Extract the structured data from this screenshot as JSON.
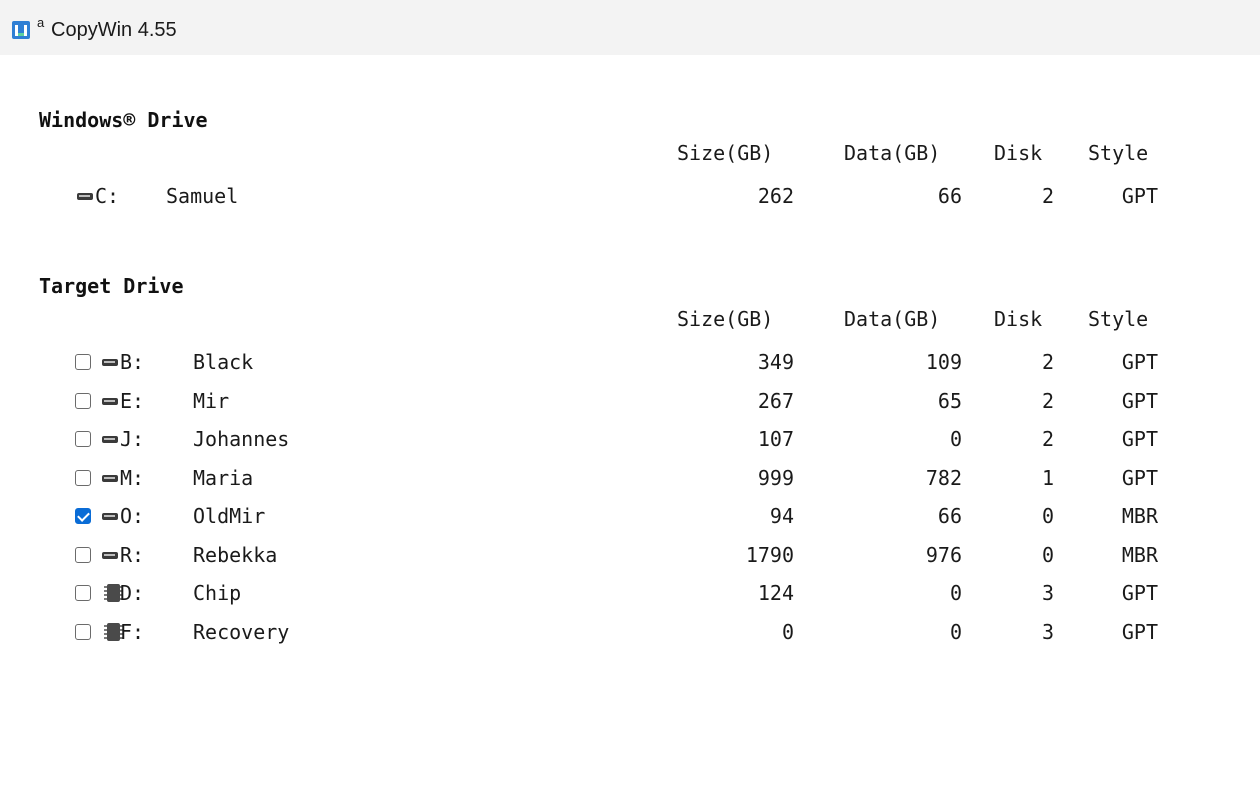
{
  "window": {
    "superscript": "a",
    "title": "CopyWin 4.55"
  },
  "windows_drive": {
    "heading": "Windows® Drive",
    "headers": {
      "size": "Size(GB)",
      "data": "Data(GB)",
      "disk": "Disk",
      "style": "Style"
    },
    "drive": {
      "letter": "C:",
      "label": "Samuel",
      "size": "262",
      "data": "66",
      "disk": "2",
      "style": "GPT",
      "icon": "drive-icon"
    }
  },
  "target_drive": {
    "heading": "Target Drive",
    "headers": {
      "size": "Size(GB)",
      "data": "Data(GB)",
      "disk": "Disk",
      "style": "Style"
    },
    "rows": [
      {
        "checked": false,
        "icon": "drive-icon",
        "letter": "B:",
        "label": "Black",
        "size": "349",
        "data": "109",
        "disk": "2",
        "style": "GPT"
      },
      {
        "checked": false,
        "icon": "drive-icon",
        "letter": "E:",
        "label": "Mir",
        "size": "267",
        "data": "65",
        "disk": "2",
        "style": "GPT"
      },
      {
        "checked": false,
        "icon": "drive-icon",
        "letter": "J:",
        "label": "Johannes",
        "size": "107",
        "data": "0",
        "disk": "2",
        "style": "GPT"
      },
      {
        "checked": false,
        "icon": "drive-icon",
        "letter": "M:",
        "label": "Maria",
        "size": "999",
        "data": "782",
        "disk": "1",
        "style": "GPT"
      },
      {
        "checked": true,
        "icon": "drive-icon",
        "letter": "O:",
        "label": "OldMir",
        "size": "94",
        "data": "66",
        "disk": "0",
        "style": "MBR"
      },
      {
        "checked": false,
        "icon": "drive-icon",
        "letter": "R:",
        "label": "Rebekka",
        "size": "1790",
        "data": "976",
        "disk": "0",
        "style": "MBR"
      },
      {
        "checked": false,
        "icon": "chip-icon",
        "letter": "D:",
        "label": "Chip",
        "size": "124",
        "data": "0",
        "disk": "3",
        "style": "GPT"
      },
      {
        "checked": false,
        "icon": "chip-icon",
        "letter": "F:",
        "label": "Recovery",
        "size": "0",
        "data": "0",
        "disk": "3",
        "style": "GPT"
      }
    ]
  },
  "colors": {
    "titlebar_bg": "#f3f3f3",
    "checkbox_checked": "#0a6cd6",
    "app_icon": "#2f7fd4"
  }
}
